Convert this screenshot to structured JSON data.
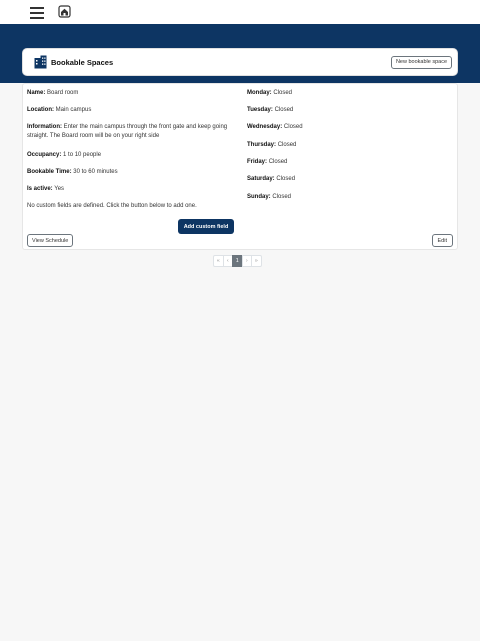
{
  "nav": {
    "menu_icon": "hamburger-menu-icon",
    "home_icon": "home-icon"
  },
  "header": {
    "title": "Bookable Spaces",
    "title_icon": "building-icon",
    "new_space_label": "New bookable space"
  },
  "space": {
    "name_label": "Name:",
    "name": "Board room",
    "location_label": "Location:",
    "location": "Main campus",
    "information_label": "Information:",
    "information": "Enter the main campus through the front gate and keep going straight. The Board room will be on your right side",
    "occupancy_label": "Occupancy:",
    "occupancy": "1 to 10 people",
    "bookable_time_label": "Bookable Time:",
    "bookable_time": "30 to 60 minutes",
    "is_active_label": "Is active:",
    "is_active": "Yes",
    "custom_fields_note": "No custom fields are defined. Click the button below to add one.",
    "add_custom_field_label": "Add custom field",
    "view_schedule_label": "View Schedule",
    "edit_label": "Edit"
  },
  "hours": [
    {
      "day": "Monday:",
      "status": "Closed"
    },
    {
      "day": "Tuesday:",
      "status": "Closed"
    },
    {
      "day": "Wednesday:",
      "status": "Closed"
    },
    {
      "day": "Thursday:",
      "status": "Closed"
    },
    {
      "day": "Friday:",
      "status": "Closed"
    },
    {
      "day": "Saturday:",
      "status": "Closed"
    },
    {
      "day": "Sunday:",
      "status": "Closed"
    }
  ],
  "pagination": {
    "first": "«",
    "prev": "‹",
    "current": "1",
    "next": "›",
    "last": "»"
  },
  "colors": {
    "banner": "#0d3563",
    "primary_button": "#0d3563",
    "active_page": "#6c757d"
  }
}
